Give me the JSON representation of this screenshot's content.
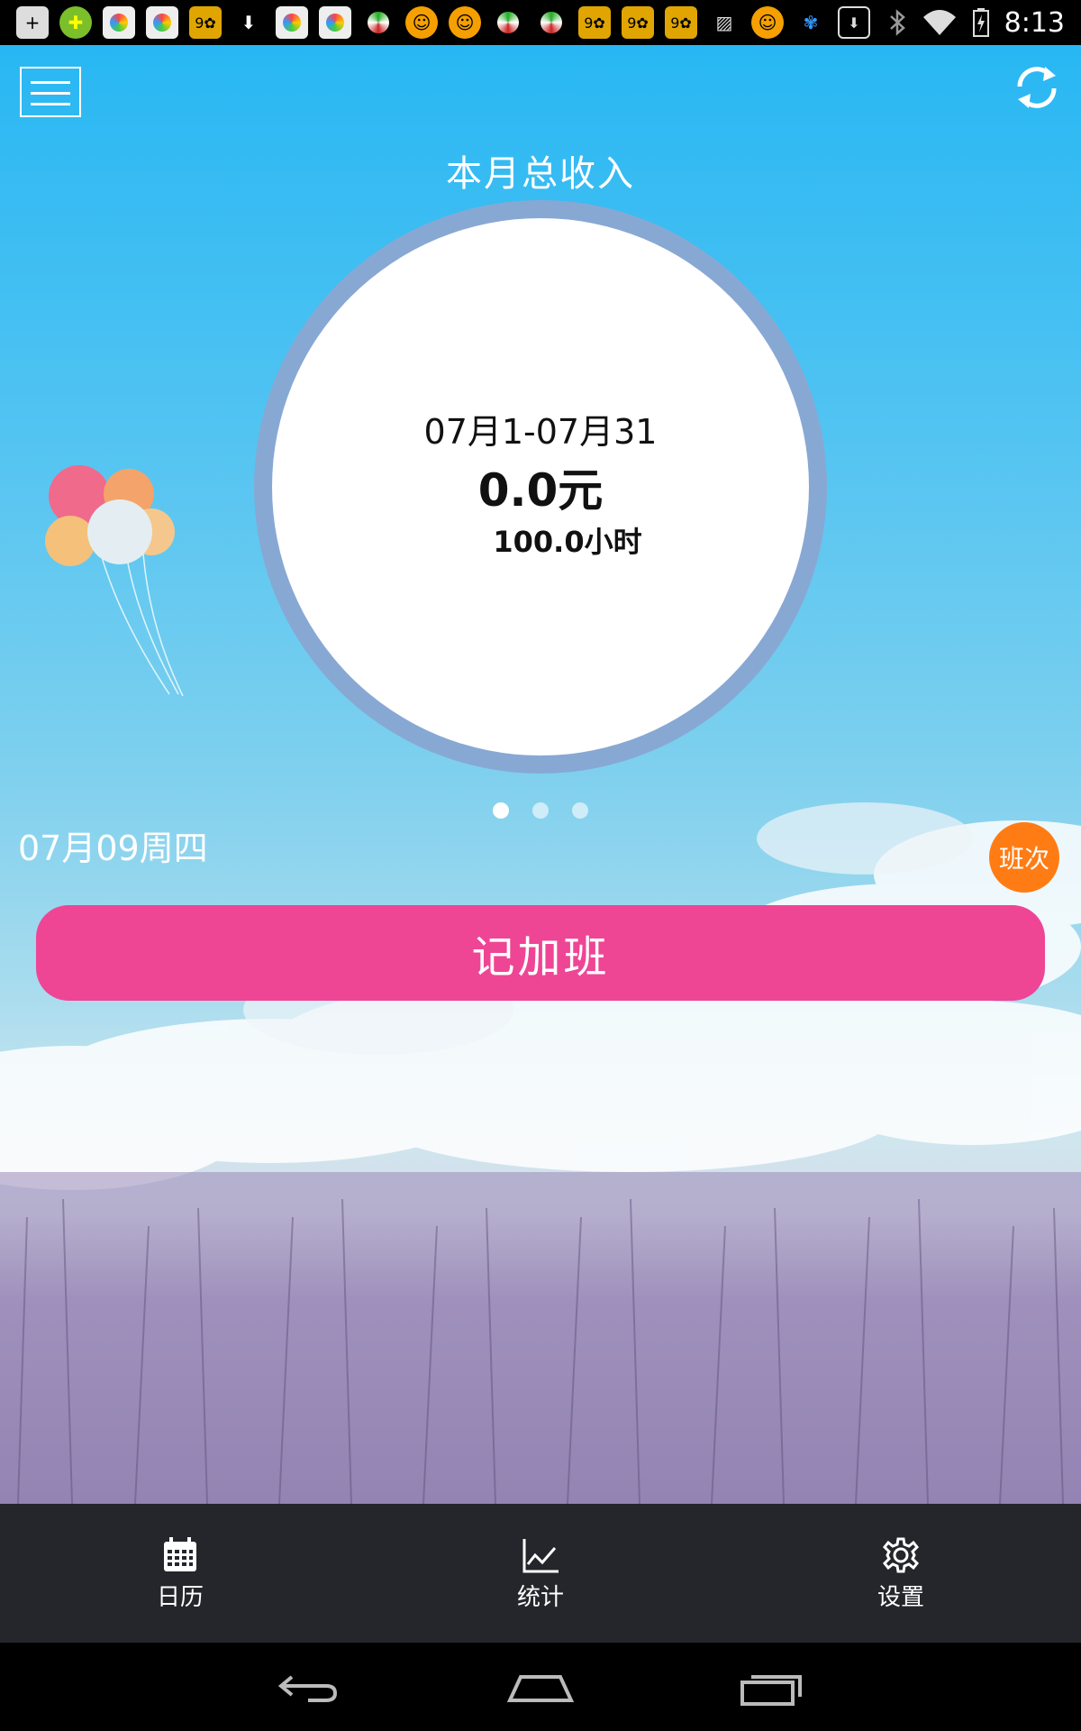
{
  "status_bar": {
    "time": "8:13",
    "notification_icons": [
      "add-icon",
      "game-icon",
      "app-icon",
      "app-icon",
      "app-icon",
      "download-icon",
      "app-icon",
      "app-icon",
      "app-icon",
      "app-icon",
      "app-icon",
      "app-icon",
      "app-icon",
      "app-icon",
      "app-icon",
      "app-icon",
      "image-icon",
      "app-icon",
      "app-icon",
      "download-box-icon"
    ],
    "system_icons": [
      "bluetooth-icon",
      "wifi-icon",
      "battery-icon"
    ]
  },
  "header": {
    "menu_icon": "hamburger-menu-icon",
    "refresh_icon": "refresh-icon"
  },
  "summary": {
    "title": "本月总收入",
    "range": "07月1-07月31",
    "amount": "0.0元",
    "hours": "100.0小时",
    "page_count": 3,
    "active_page": 1
  },
  "today": {
    "date": "07月09周四",
    "shift_label": "班次"
  },
  "actions": {
    "overtime_label": "记加班"
  },
  "tabs": [
    {
      "icon": "calendar-icon",
      "label": "日历"
    },
    {
      "icon": "chart-icon",
      "label": "统计"
    },
    {
      "icon": "gear-icon",
      "label": "设置"
    }
  ],
  "colors": {
    "sky_top": "#28b7f3",
    "ring": "#88a8d4",
    "overtime_button": "#ef4595",
    "shift_button": "#ff7c14",
    "tabbar": "#25262b"
  }
}
